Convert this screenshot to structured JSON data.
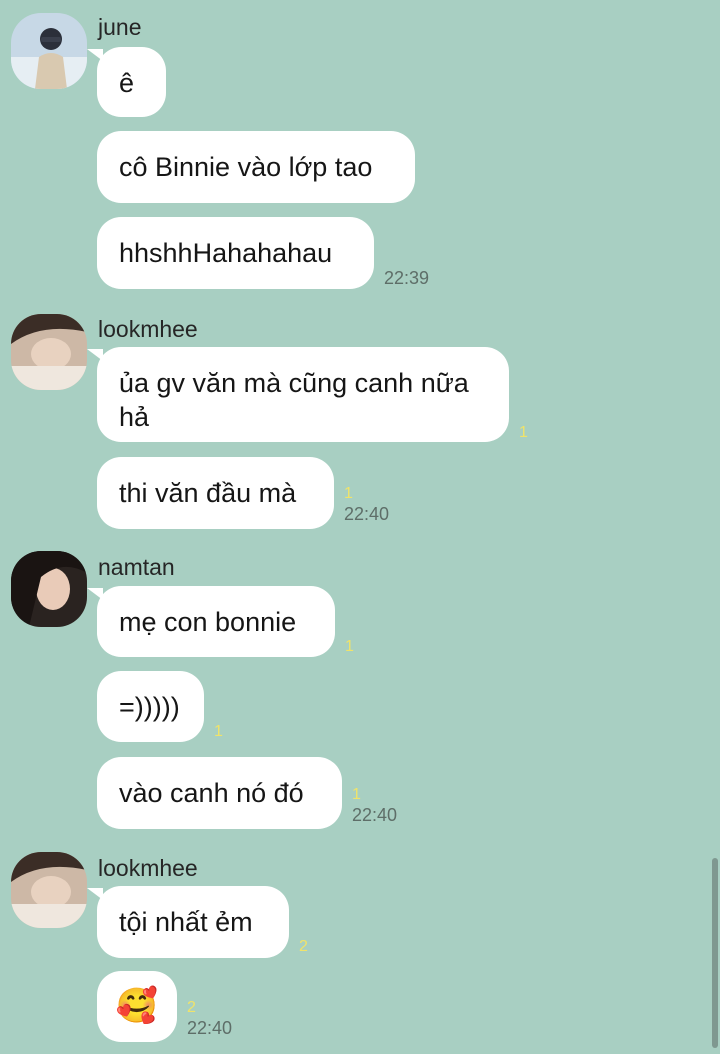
{
  "messages": [
    {
      "sender": "june",
      "lines": [
        {
          "text": "ê"
        },
        {
          "text": "cô Binnie vào lớp tao"
        },
        {
          "text": "hhshhHahahahau",
          "time": "22:39"
        }
      ]
    },
    {
      "sender": "lookmhee",
      "lines": [
        {
          "text": "ủa gv văn mà cũng canh nữa hả",
          "count": "1"
        },
        {
          "text": "thi văn đầu mà",
          "count": "1",
          "time": "22:40"
        }
      ]
    },
    {
      "sender": "namtan",
      "lines": [
        {
          "text": "mẹ con bonnie",
          "count": "1"
        },
        {
          "text": "=)))))",
          "count": "1"
        },
        {
          "text": "vào canh nó đó",
          "count": "1",
          "time": "22:40"
        }
      ]
    },
    {
      "sender": "lookmhee",
      "lines": [
        {
          "text": "tội nhất ẻm",
          "count": "2"
        },
        {
          "text": "🥰",
          "count": "2",
          "time": "22:40"
        }
      ]
    }
  ]
}
